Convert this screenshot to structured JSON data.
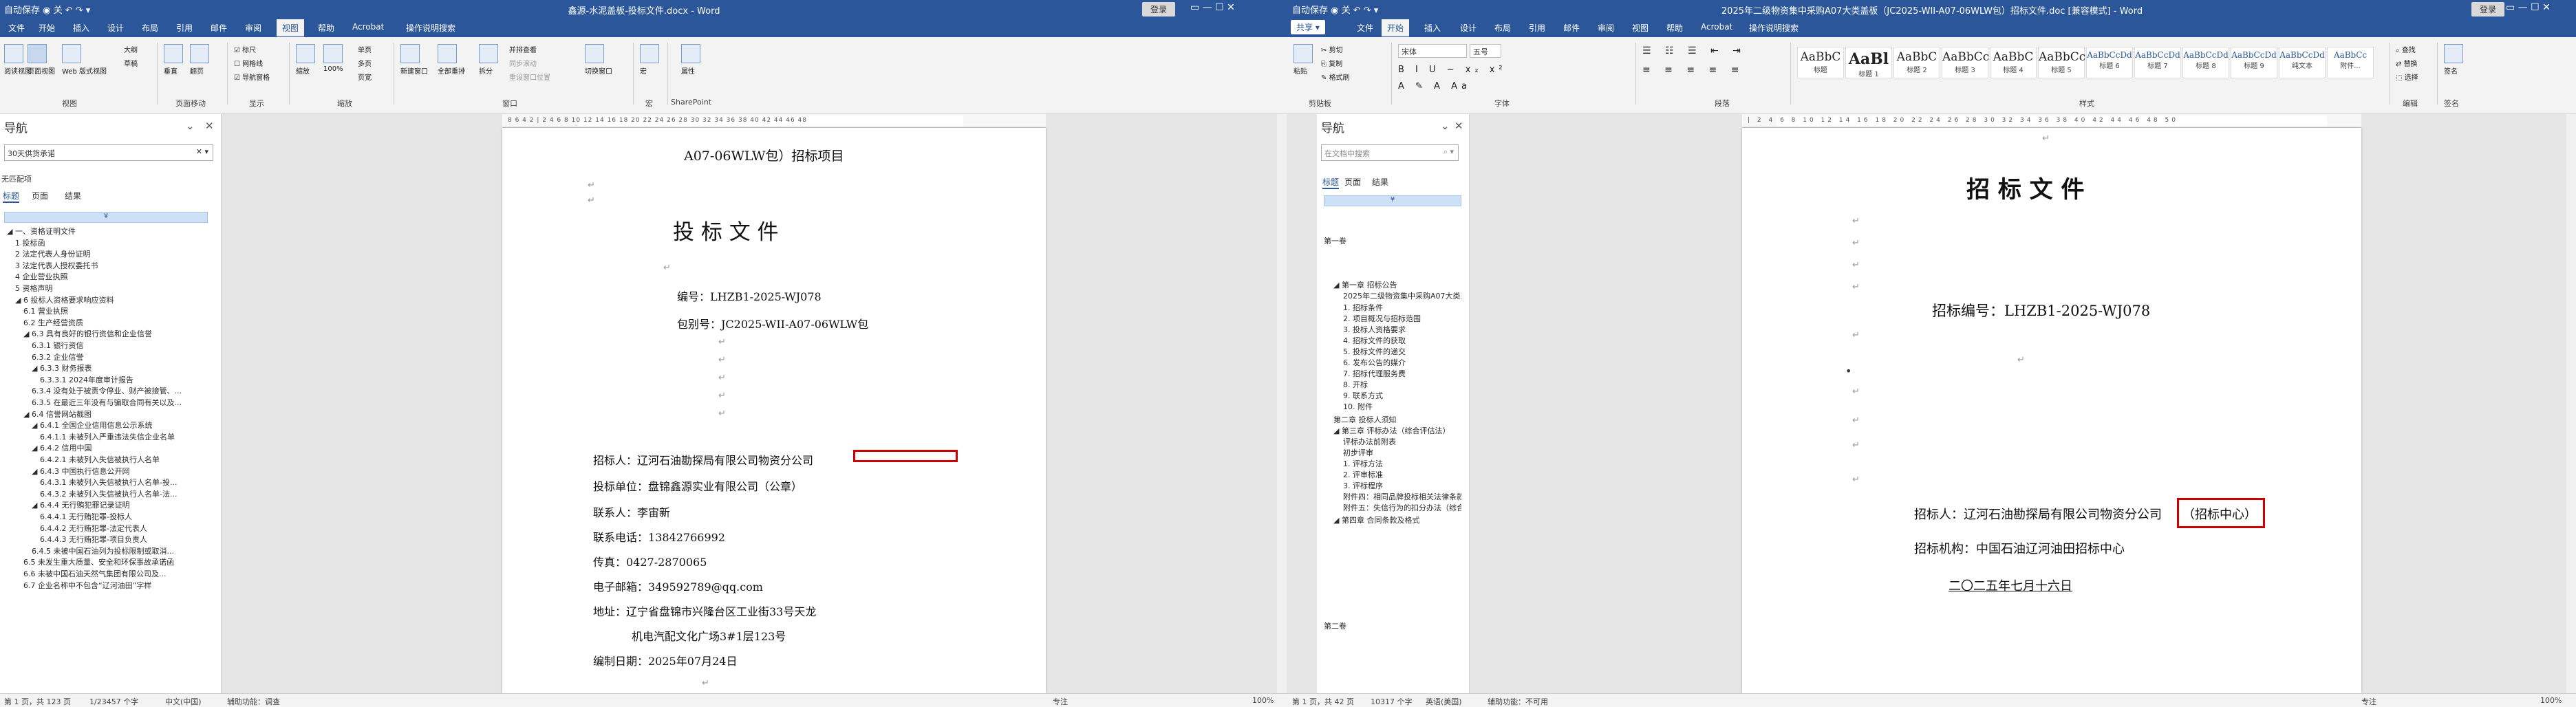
{
  "left": {
    "qa": "自动保存 ◉ 关 ↶ ↷ ▾",
    "title": "鑫源-水泥盖板-投标文件.docx  -  Word",
    "login": "登录",
    "controls": "▭   —   ☐   ✕",
    "tabs": [
      "文件",
      "开始",
      "插入",
      "设计",
      "布局",
      "引用",
      "邮件",
      "审阅",
      "视图",
      "帮助",
      "Acrobat",
      "操作说明搜索"
    ],
    "active_tab": "视图",
    "ribbon": {
      "views": [
        "阅读视图",
        "页面视图",
        "Web 版式视图"
      ],
      "views2": [
        "大纲",
        "草稿"
      ],
      "group_views": "视图",
      "pagemove": [
        "垂直",
        "翻页"
      ],
      "group_pagemove": "页面移动",
      "show": [
        "标尺",
        "网格线",
        "导航窗格"
      ],
      "group_show": "显示",
      "zoom": [
        "缩放",
        "100%"
      ],
      "zoom2": [
        "单页",
        "多页",
        "页宽"
      ],
      "group_zoom": "缩放",
      "window": [
        "新建窗口",
        "全部重排",
        "拆分"
      ],
      "window2": [
        "并排查看",
        "同步滚动",
        "重设窗口位置"
      ],
      "switch": "切换窗口",
      "group_window": "窗口",
      "macro": "宏",
      "group_macro": "宏",
      "sharepoint": "属性",
      "group_sp": "SharePoint"
    },
    "nav": {
      "title": "导航",
      "search": "30天供货承诺",
      "result": "无匹配项",
      "tabs": [
        "标题",
        "页面",
        "结果"
      ],
      "items": [
        "一、资格证明文件",
        "1 投标函",
        "2 法定代表人身份证明",
        "3 法定代表人授权委托书",
        "4 企业营业执照",
        "5 资格声明",
        "6 投标人资格要求响应资料",
        "6.1 营业执照",
        "6.2 生产经营资质",
        "6.3 具有良好的银行资信和企业信誉",
        "6.3.1 银行资信",
        "6.3.2 企业信誉",
        "6.3.3 财务报表",
        "6.3.3.1 2024年度审计报告",
        "6.3.4 没有处于被责令停业、财产被接管、...",
        "6.3.5 在最近三年没有与骗取合同有关以及...",
        "6.4 信誉网站截图",
        "6.4.1 全国企业信用信息公示系统",
        "6.4.1.1 未被列入严重违法失信企业名单",
        "6.4.2 信用中国",
        "6.4.2.1 未被列入失信被执行人名单",
        "6.4.3 中国执行信息公开网",
        "6.4.3.1 未被列入失信被执行人名单-投...",
        "6.4.3.2 未被列入失信被执行人名单-法...",
        "6.4.4 无行贿犯罪记录证明",
        "6.4.4.1 无行贿犯罪-投标人",
        "6.4.4.2 无行贿犯罪-法定代表人",
        "6.4.4.3 无行贿犯罪-项目负责人",
        "6.4.5 未被中国石油列为投标限制或取消...",
        "6.5 未发生重大质量、安全和环保事故承诺函",
        "6.6 未被中国石油天然气集团有限公司及...",
        "6.7 企业名称中不包含“辽河油田”字样"
      ]
    },
    "ruler": "8  6  4  2  |  2  4  6  8  10  12  14  16  18  20  22  24  26  28  30  32  34  36  38  40  42  44  46  48",
    "doc": {
      "l1": "A07-06WLW包）招标项目",
      "l2": "投  标  文  件",
      "l3": "编号：LHZB1-2025-WJ078",
      "l4": "包别号：JC2025-WII-A07-06WLW包",
      "l5": "招标人：辽河石油勘探局有限公司物资分公司",
      "l6": "投标单位：盘锦鑫源实业有限公司（公章）",
      "l7": "联系人：李宙新",
      "l8": "联系电话：13842766992",
      "l9": "传真：0427-2870065",
      "l10": "电子邮箱：349592789@qq.com",
      "l11": "地址：辽宁省盘锦市兴隆台区工业街33号天龙",
      "l12": "机电汽配文化广场3#1层123号",
      "l13": "编制日期：2025年07月24日"
    },
    "status": [
      "第 1 页，共 123 页",
      "1/23457 个字",
      "中文(中国)",
      "辅助功能：调查",
      "专注",
      "100%"
    ]
  },
  "right": {
    "qa": "自动保存 ◉ 关 ↶ ↷ ▾",
    "title": "2025年二级物资集中采购A07大类盖板（JC2025-WII-A07-06WLW包）招标文件.doc [兼容模式]  -  Word",
    "login": "登录",
    "controls": "▭   —   ☐   ✕",
    "share": "共享 ▾",
    "tabs": [
      "文件",
      "开始",
      "插入",
      "设计",
      "布局",
      "引用",
      "邮件",
      "审阅",
      "视图",
      "帮助",
      "Acrobat",
      "操作说明搜索"
    ],
    "active_tab": "开始",
    "ribbon": {
      "paste": "粘贴",
      "clip": [
        "剪切",
        "复制",
        "格式刷"
      ],
      "group_clip": "剪贴板",
      "font_name": "宋体",
      "font_size": "五号",
      "group_font": "字体",
      "group_para": "段落",
      "styles": [
        {
          "s": "AaBbC",
          "n": "标题"
        },
        {
          "s": "AaBl",
          "n": "标题 1"
        },
        {
          "s": "AaBbC",
          "n": "标题 2"
        },
        {
          "s": "AaBbCcI",
          "n": "标题 3"
        },
        {
          "s": "AaBbC",
          "n": "标题 4"
        },
        {
          "s": "AaBbCcD",
          "n": "标题 5"
        },
        {
          "s": "AaBbCcDd",
          "n": "标题 6"
        },
        {
          "s": "AaBbCcDd",
          "n": "标题 7"
        },
        {
          "s": "AaBbCcDd",
          "n": "标题 8"
        },
        {
          "s": "AaBbCcDd",
          "n": "标题 9"
        },
        {
          "s": "AaBbCcDd",
          "n": "纯文本"
        },
        {
          "s": "AaBbCc",
          "n": "附件..."
        }
      ],
      "group_styles": "样式",
      "edit": [
        "查找",
        "替换",
        "选择"
      ],
      "group_edit": "编辑",
      "sign": "签名",
      "group_sign": "签名"
    },
    "nav": {
      "title": "导航",
      "search": "在文档中搜索",
      "tabs": [
        "标题",
        "页面",
        "结果"
      ],
      "items": [
        "第一卷",
        "第一章 招标公告",
        "2025年二级物资集中采购A07大类盖板（JC2...",
        "1. 招标条件",
        "2. 项目概况与招标范围",
        "3. 投标人资格要求",
        "4. 招标文件的获取",
        "5. 投标文件的递交",
        "6. 发布公告的媒介",
        "7. 招标代理服务费",
        "8. 开标",
        "9. 联系方式",
        "10. 附件",
        "第二章 投标人须知",
        "第三章 评标办法（综合评估法）",
        "评标办法前附表",
        "初步评审",
        "1. 评标方法",
        "2. 评审标准",
        "3. 评标程序",
        "附件四：相同品牌投标相关法律条款",
        "附件五：失信行为的扣分办法（综合评估法）",
        "第四章 合同条款及格式",
        "第二卷"
      ]
    },
    "ruler": "|  2  4  6  8  10  12  14  16  18  20  22  24  26  28  30  32  34  36  38  40  42  44  46  48  50",
    "doc": {
      "l1": "招  标  文  件",
      "l2": "招标编号：LHZB1-2025-WJ078",
      "l3a": "招标人：辽河石油勘探局有限公司物资分公司",
      "l3b": "（招标中心）",
      "l4": "招标机构：中国石油辽河油田招标中心",
      "l5": "二〇二五年七月十六日"
    },
    "status": [
      "第 1 页，共 42 页",
      "10317 个字",
      "英语(美国)",
      "辅助功能：不可用",
      "专注",
      "100%"
    ]
  },
  "colors": {
    "accent": "#2b579a",
    "highlight": "#cc0000"
  }
}
